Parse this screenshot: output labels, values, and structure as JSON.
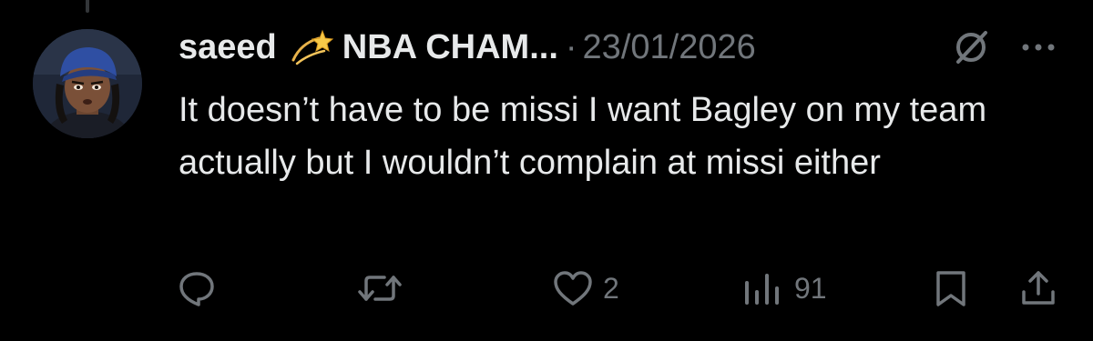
{
  "tweet": {
    "author": {
      "display_name": "saeed",
      "badge_emoji": "dizzy-star-emoji",
      "handle_truncated": "NBA CHAM...",
      "separator": "·",
      "avatar": "cartoon-character-avatar"
    },
    "date": "23/01/2026",
    "text": "It doesn’t have to be missi I want Bagley on my team actually but I wouldn’t complain at missi either",
    "actions": {
      "reply": {
        "icon": "reply-icon",
        "count": ""
      },
      "retweet": {
        "icon": "retweet-icon",
        "count": ""
      },
      "like": {
        "icon": "heart-icon",
        "count": "2"
      },
      "views": {
        "icon": "views-chart-icon",
        "count": "91"
      },
      "bookmark": {
        "icon": "bookmark-icon"
      },
      "share": {
        "icon": "share-icon"
      }
    },
    "header_icons": {
      "grok": "grok-icon",
      "more": "more-options-icon"
    }
  },
  "colors": {
    "background": "#000000",
    "primary_text": "#e7e9ea",
    "secondary_text": "#71767b",
    "thread_line": "#333639"
  }
}
